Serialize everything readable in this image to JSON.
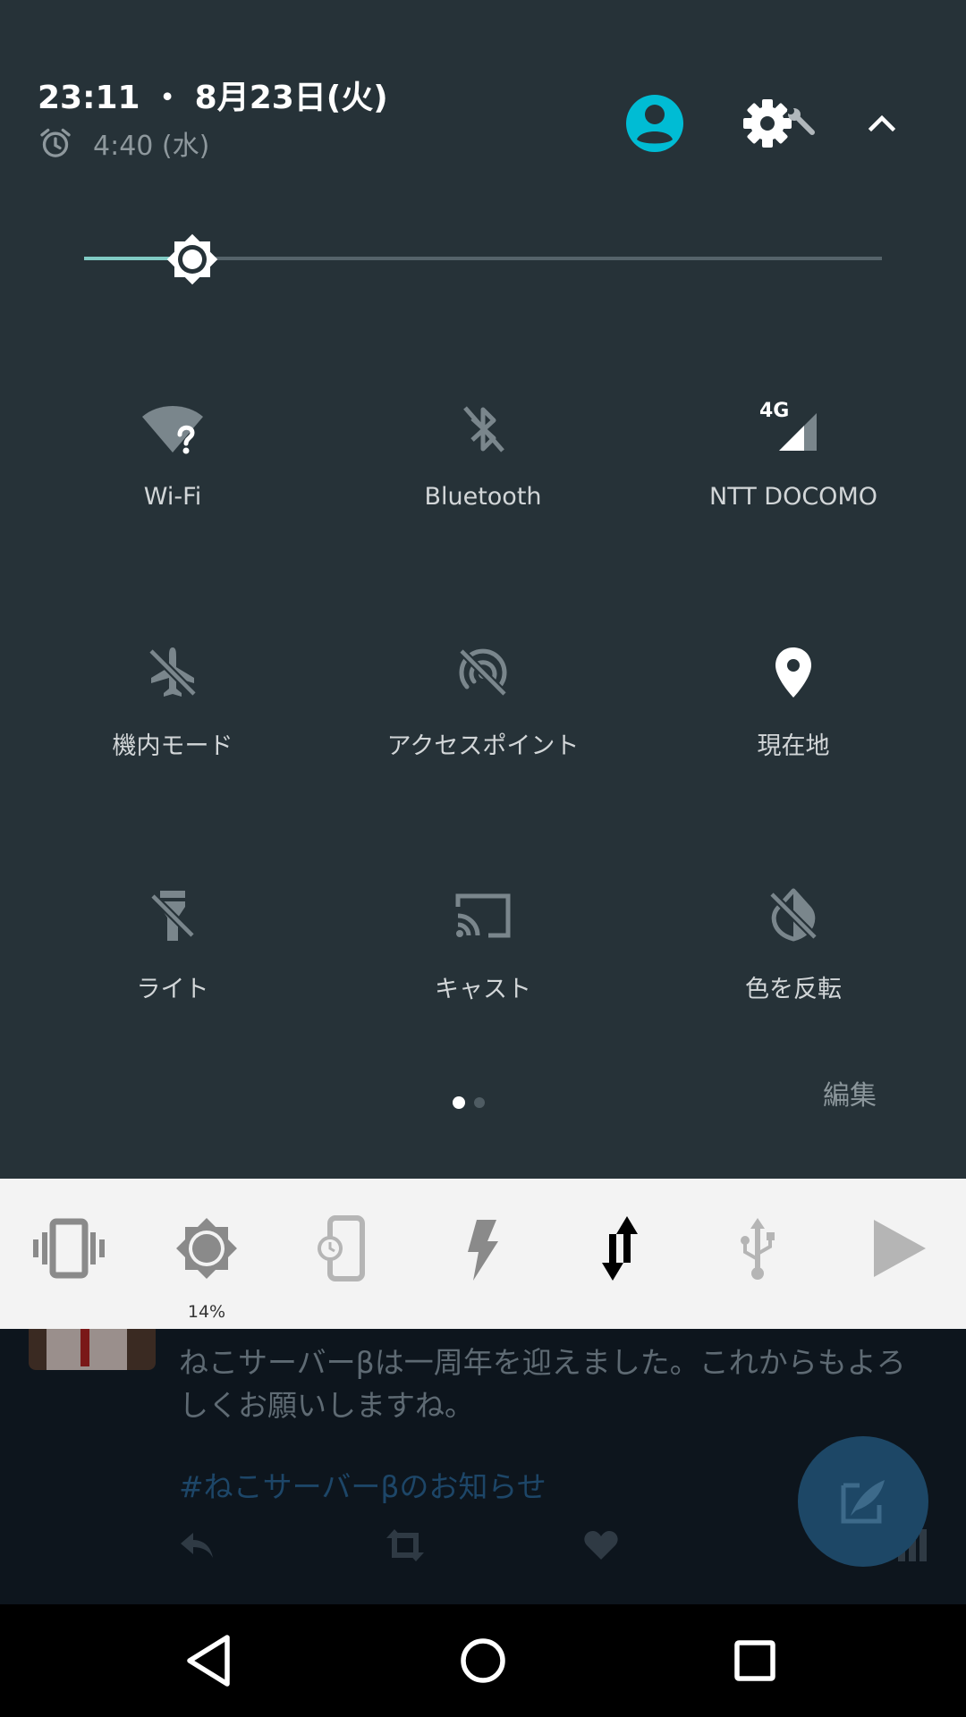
{
  "header": {
    "time_date": "23:11 ・ 8月23日(火)",
    "next_alarm": "4:40 (水)",
    "alarm_icon": "alarm-clock-icon",
    "user_icon": "account-circle-icon",
    "settings_icon": "settings-gear-wrench-icon",
    "collapse_icon": "chevron-up-icon"
  },
  "brightness": {
    "level": 0.14,
    "thumb_icon": "brightness-icon"
  },
  "tiles": [
    {
      "label": "Wi-Fi",
      "icon": "wifi-unknown-icon"
    },
    {
      "label": "Bluetooth",
      "icon": "bluetooth-off-icon"
    },
    {
      "label": "NTT DOCOMO",
      "icon": "cellular-4g-icon",
      "network_type": "4G"
    },
    {
      "label": "機内モード",
      "icon": "airplane-off-icon"
    },
    {
      "label": "アクセスポイント",
      "icon": "hotspot-off-icon"
    },
    {
      "label": "現在地",
      "icon": "location-pin-icon"
    },
    {
      "label": "ライト",
      "icon": "flashlight-off-icon"
    },
    {
      "label": "キャスト",
      "icon": "cast-icon"
    },
    {
      "label": "色を反転",
      "icon": "invert-colors-off-icon"
    }
  ],
  "page_indicator": {
    "pages": 2,
    "current": 1
  },
  "edit_label": "編集",
  "power_toggles": [
    {
      "icon": "vibrate-icon"
    },
    {
      "icon": "brightness-icon",
      "caption": "14%"
    },
    {
      "icon": "screen-timeout-icon"
    },
    {
      "icon": "flash-icon"
    },
    {
      "icon": "mobile-data-icon"
    },
    {
      "icon": "usb-icon"
    },
    {
      "icon": "play-icon"
    }
  ],
  "background_app": {
    "tweet_text": "ねこサーバーβは一周年を迎えました。これからもよろしくお願いしますね。",
    "hashtag": "#ねこサーバーβのお知らせ",
    "actions": [
      "reply-icon",
      "retweet-icon",
      "like-icon",
      "stats-icon"
    ],
    "fab_icon": "compose-tweet-icon"
  },
  "navigation": [
    "back-icon",
    "home-icon",
    "recents-icon"
  ],
  "colors": {
    "panel_bg": "#263238",
    "accent": "#00bcd4",
    "brightness_fill": "#80cbc4",
    "strip_bg": "#f3f3f3",
    "fab": "#1d4766"
  }
}
